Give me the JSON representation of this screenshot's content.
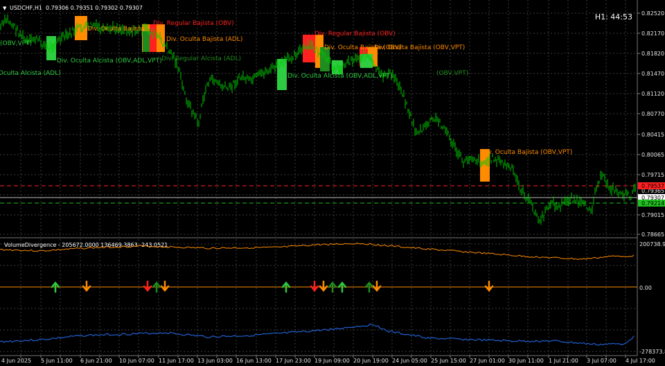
{
  "header": {
    "symbol": "USDCHF,H1",
    "ohlc": "0.79306 0.79351 0.79302 0.79307",
    "timer": "H1: 44:53"
  },
  "price_axis": {
    "ticks": [
      "0.82520",
      "0.82170",
      "0.81820",
      "0.81470",
      "0.81120",
      "0.80770",
      "0.80415",
      "0.80065",
      "0.79715",
      "0.79365",
      "0.79015",
      "0.78665"
    ],
    "badges": {
      "red": "0.79537",
      "white": "0.79307",
      "green": "0.79214"
    }
  },
  "time_axis": {
    "labels": [
      "4 Jun 2025",
      "5 Jun 11:00",
      "6 Jun 21:00",
      "10 Jun 07:00",
      "11 Jun 17:00",
      "13 Jun 03:00",
      "16 Jun 13:00",
      "17 Jun 23:00",
      "19 Jun 09:00",
      "20 Jun 19:00",
      "24 Jun 05:00",
      "25 Jun 15:00",
      "27 Jun 01:00",
      "30 Jun 11:00",
      "1 Jul 21:00",
      "3 Jul 07:00",
      "4 Jul 17:00"
    ]
  },
  "indicator": {
    "title": "VolumeDivergence - 205672.0000 136469.3863 -243.0521",
    "axis": {
      "top": "200738.93",
      "middle": "0.00",
      "bottom": "-278373.8"
    }
  },
  "annotations": [
    {
      "text": "Div. Oculta Bajista",
      "color": "#ff8c00"
    },
    {
      "text": "Div. Regular Bajista (OBV)",
      "color": "#ff2020"
    },
    {
      "text": "Div. Oculta Bajista (ADL)",
      "color": "#ff8c00"
    },
    {
      "text": "Div. Oculta Alcista (OBV,ADL,VPT)",
      "color": "#2ecc40"
    },
    {
      "text": "Div. Regular Alcista (ADL)",
      "color": "#1e8c1e"
    },
    {
      "text": "Div. Oculta Alcista (ADL)",
      "color": "#2ecc40"
    },
    {
      "text": "Div. Regular Bajista (OBV)",
      "color": "#ff2020"
    },
    {
      "text": "Div. Oculta Bajista (OBV)",
      "color": "#ff8c00"
    },
    {
      "text": "Div. Oculta Bajista (OBV,VPT)",
      "color": "#ff8c00"
    },
    {
      "text": "Div. Oculta Alcista (OBV,ADL,VPT)",
      "color": "#2ecc40"
    },
    {
      "text": "Div. Oculta Bajista (OBV,VPT)",
      "color": "#ff8c00"
    },
    {
      "text": "(OBV,VPT)",
      "color": "#2ecc40"
    },
    {
      "text": "(OBV,VPT)",
      "color": "#1e8c1e"
    }
  ],
  "colors": {
    "background": "#000000",
    "grid": "#3a3a3a",
    "candle": "#00c800",
    "obv": "#ff8c00",
    "adl": "#2060d0",
    "zero": "#ff8c00",
    "red_level": "#ff2020",
    "green_level": "#20c020"
  }
}
